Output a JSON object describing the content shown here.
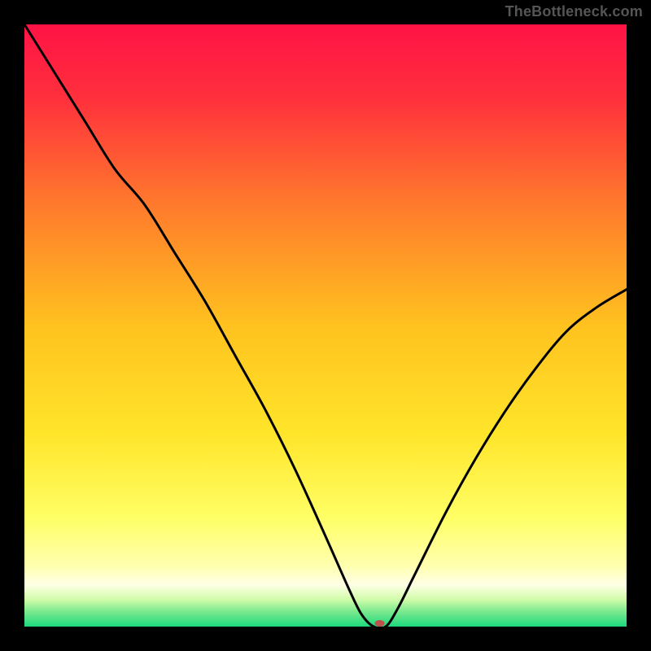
{
  "watermark": {
    "text": "TheBottleneck.com"
  },
  "chart_data": {
    "type": "line",
    "title": "",
    "xlabel": "",
    "ylabel": "",
    "xlim": [
      0,
      100
    ],
    "ylim": [
      0,
      100
    ],
    "grid": false,
    "legend": false,
    "gradient_stops": [
      {
        "offset": 0.0,
        "color": "#ff1345"
      },
      {
        "offset": 0.12,
        "color": "#ff2f3d"
      },
      {
        "offset": 0.3,
        "color": "#ff7a2c"
      },
      {
        "offset": 0.5,
        "color": "#ffc21f"
      },
      {
        "offset": 0.68,
        "color": "#ffe52a"
      },
      {
        "offset": 0.82,
        "color": "#ffff66"
      },
      {
        "offset": 0.9,
        "color": "#ffffb0"
      },
      {
        "offset": 0.93,
        "color": "#ffffe6"
      },
      {
        "offset": 0.955,
        "color": "#d1fcaa"
      },
      {
        "offset": 0.975,
        "color": "#7ae98e"
      },
      {
        "offset": 1.0,
        "color": "#1ed87d"
      }
    ],
    "series": [
      {
        "name": "bottleneck-curve",
        "x": [
          0,
          5,
          10,
          15,
          20,
          25,
          30,
          35,
          40,
          45,
          50,
          54,
          56,
          58,
          60,
          62,
          65,
          70,
          75,
          80,
          85,
          90,
          95,
          100
        ],
        "values": [
          100,
          92,
          84,
          76,
          70,
          62,
          54,
          45,
          36,
          26,
          15,
          6,
          2,
          0,
          0,
          3,
          9,
          19,
          28,
          36,
          43,
          49,
          53,
          56
        ]
      }
    ],
    "marker": {
      "x": 59,
      "y": 0,
      "color": "#c0504d",
      "rx": 6,
      "ry": 4
    }
  }
}
